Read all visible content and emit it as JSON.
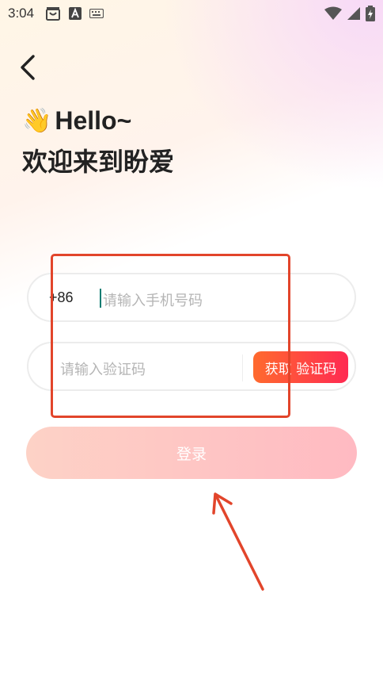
{
  "status_bar": {
    "time": "3:04",
    "left_icons": [
      "shopping-bag-icon",
      "a-box-icon",
      "keyboard-icon"
    ],
    "right_icons": [
      "wifi-icon",
      "signal-icon",
      "battery-charging-icon"
    ]
  },
  "header": {
    "back_icon": "chevron-left-icon",
    "hello_emoji": "👋",
    "hello_text": "Hello~",
    "welcome_text": "欢迎来到盼爱"
  },
  "form": {
    "country_code": "+86",
    "phone_placeholder": "请输入手机号码",
    "code_placeholder": "请输入验证码",
    "get_code_label": "获取 验证码",
    "login_label": "登录"
  },
  "colors": {
    "accent_gradient_start": "#ff6a2e",
    "accent_gradient_end": "#ff2a52",
    "login_gradient_start": "#fdd2c6",
    "login_gradient_end": "#ffbac2",
    "annotation": "#e2452b"
  }
}
